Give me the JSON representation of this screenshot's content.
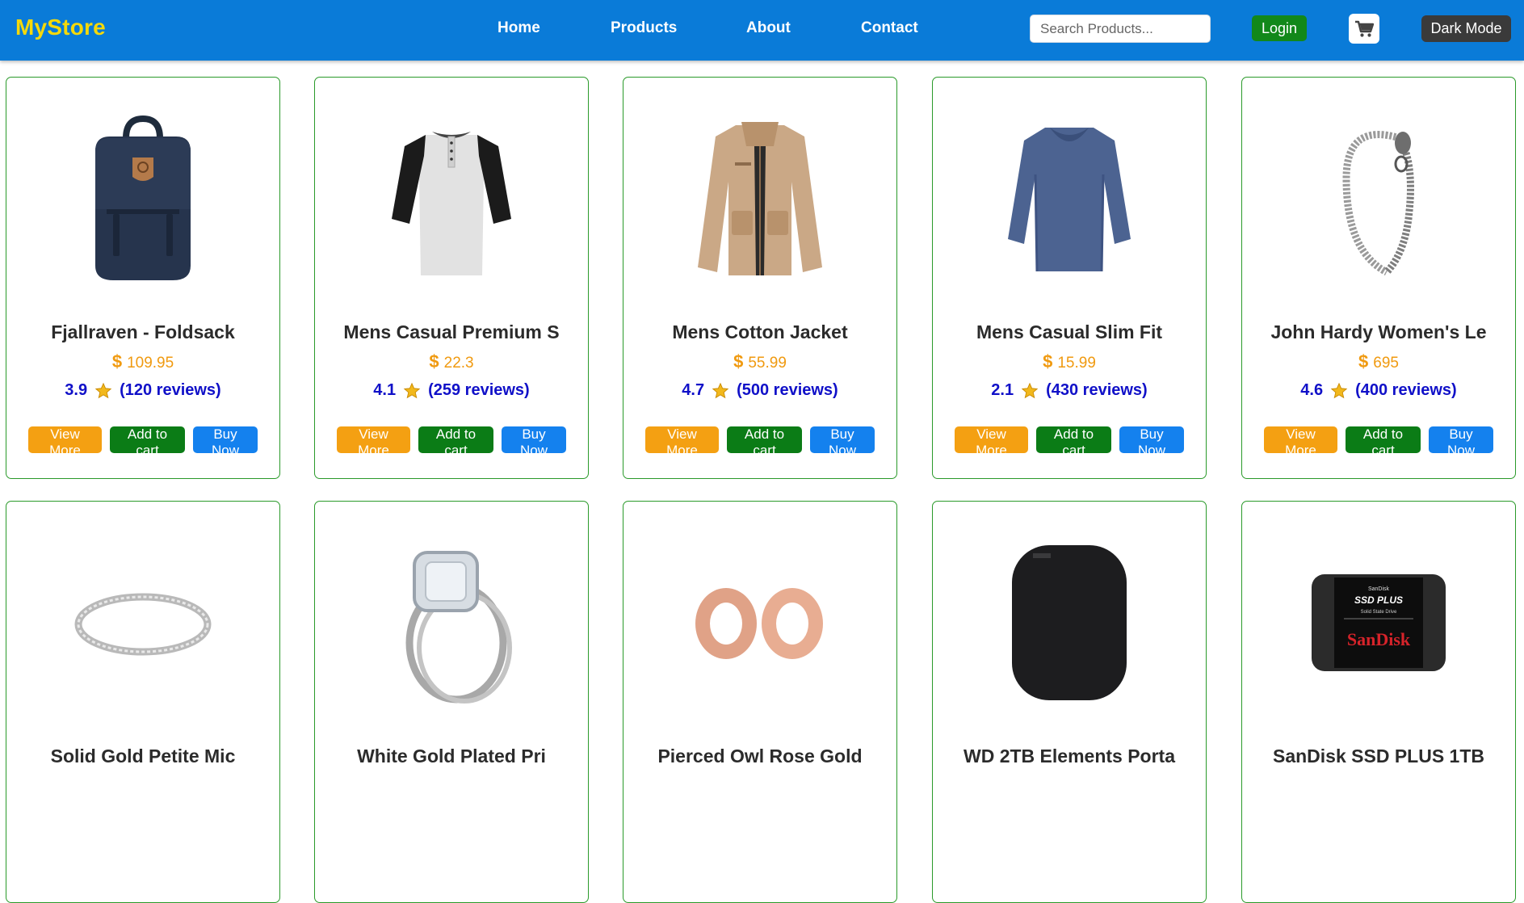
{
  "nav": {
    "brand": "MyStore",
    "links": [
      "Home",
      "Products",
      "About",
      "Contact"
    ],
    "search_placeholder": "Search Products...",
    "login_label": "Login",
    "cart_icon": "cart-icon",
    "dark_mode_label": "Dark Mode"
  },
  "colors": {
    "navbar": "#0a7bd8",
    "brand": "#f5d90a",
    "card_border": "#2a9a2a",
    "price": "#f09a10",
    "rating": "#1010c8",
    "view_more": "#f4a012",
    "add_to_cart": "#0b7c16",
    "buy_now": "#1481ee"
  },
  "button_labels": {
    "view": "View More",
    "cart": "Add to cart",
    "buy": "Buy Now"
  },
  "products": [
    {
      "title": "Fjallraven - Foldsack",
      "currency": "$",
      "price": "109.95",
      "rating": "3.9",
      "reviews": "(120 reviews)",
      "image": "backpack"
    },
    {
      "title": "Mens Casual Premium S",
      "currency": "$",
      "price": "22.3",
      "rating": "4.1",
      "reviews": "(259 reviews)",
      "image": "raglan-tshirt"
    },
    {
      "title": "Mens Cotton Jacket",
      "currency": "$",
      "price": "55.99",
      "rating": "4.7",
      "reviews": "(500 reviews)",
      "image": "jacket"
    },
    {
      "title": "Mens Casual Slim Fit",
      "currency": "$",
      "price": "15.99",
      "rating": "2.1",
      "reviews": "(430 reviews)",
      "image": "long-sleeve-shirt"
    },
    {
      "title": "John Hardy Women's Le",
      "currency": "$",
      "price": "695",
      "rating": "4.6",
      "reviews": "(400 reviews)",
      "image": "chain-bracelet"
    },
    {
      "title": "Solid Gold Petite Mic",
      "image": "silver-ring"
    },
    {
      "title": "White Gold Plated Pri",
      "image": "diamond-ring"
    },
    {
      "title": "Pierced Owl Rose Gold",
      "image": "rose-gold-plugs"
    },
    {
      "title": "WD 2TB Elements Porta",
      "image": "external-hard-drive"
    },
    {
      "title": "SanDisk SSD PLUS 1TB",
      "image": "ssd-drive",
      "image_text": [
        "SanDisk",
        "SSD PLUS",
        "Solid State Drive",
        "SanDisk"
      ]
    }
  ]
}
